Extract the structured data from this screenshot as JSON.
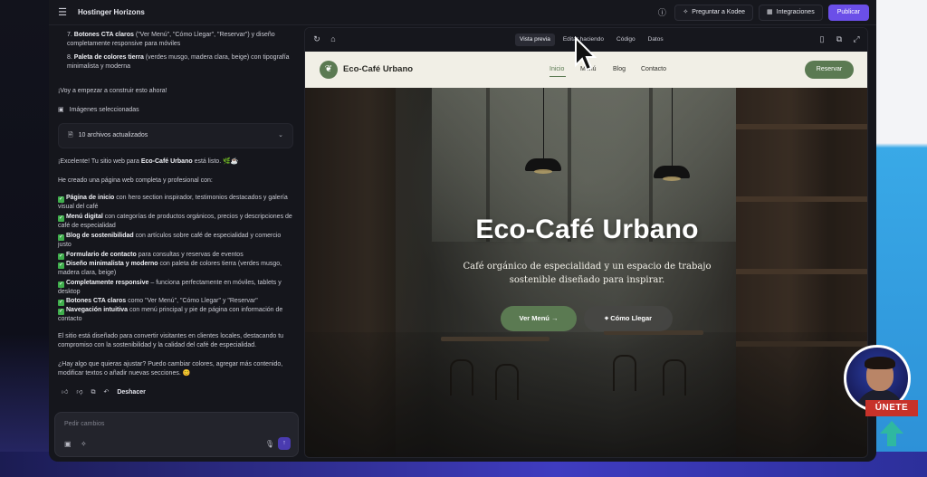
{
  "app": {
    "title": "Hostinger Horizons"
  },
  "toolbar": {
    "ask_label": "Preguntar a Kodee",
    "integrations_label": "Integraciones",
    "publish_label": "Publicar"
  },
  "chat": {
    "item7_bold": "Botones CTA claros",
    "item7_rest": " (\"Ver Menú\", \"Cómo Llegar\", \"Reservar\") y diseño completamente responsive para móviles",
    "item8_bold": "Paleta de colores tierra",
    "item8_rest": " (verdes musgo, madera clara, beige) con tipografía minimalista y moderna",
    "start_msg": "¡Voy a empezar a construir esto ahora!",
    "images_selected": "Imágenes seleccionadas",
    "files_updated": "10 archivos actualizados",
    "ready_pre": "¡Excelente! Tu sitio web para ",
    "ready_bold": "Eco-Café Urbano",
    "ready_post": " está listo. 🌿☕",
    "created_msg": "He creado una página web completa y profesional con:",
    "features": [
      {
        "bold": "Página de inicio",
        "rest": " con hero section inspirador, testimonios destacados y galería visual del café"
      },
      {
        "bold": "Menú digital",
        "rest": " con categorías de productos orgánicos, precios y descripciones de café de especialidad"
      },
      {
        "bold": "Blog de sostenibilidad",
        "rest": " con artículos sobre café de especialidad y comercio justo"
      },
      {
        "bold": "Formulario de contacto",
        "rest": " para consultas y reservas de eventos"
      },
      {
        "bold": "Diseño minimalista y moderno",
        "rest": " con paleta de colores tierra (verdes musgo, madera clara, beige)"
      },
      {
        "bold": "Completamente responsive",
        "rest": " – funciona perfectamente en móviles, tablets y desktop"
      },
      {
        "bold": "Botones CTA claros",
        "rest": " como \"Ver Menú\", \"Cómo Llegar\" y \"Reservar\""
      },
      {
        "bold": "Navegación intuitiva",
        "rest": " con menú principal y pie de página con información de contacto"
      }
    ],
    "closing": "El sitio está diseñado para convertir visitantes en clientes locales, destacando tu compromiso con la sostenibilidad y la calidad del café de especialidad.",
    "question": "¿Hay algo que quieras ajustar? Puedo cambiar colores, agregar más contenido, modificar textos o añadir nuevas secciones. 😊",
    "undo_label": "Deshacer",
    "composer_placeholder": "Pedir cambios"
  },
  "preview": {
    "tabs": [
      "Vista previa",
      "Editar haciendo",
      "Código",
      "Datos"
    ]
  },
  "site": {
    "brand": "Eco-Café Urbano",
    "nav": [
      "Inicio",
      "Menú",
      "Blog",
      "Contacto"
    ],
    "reserve": "Reservar",
    "hero_title": "Eco-Café Urbano",
    "hero_subtitle": "Café orgánico de especialidad y un espacio de trabajo sostenible diseñado para inspirar.",
    "btn_menu": "Ver Menú",
    "btn_directions": "Cómo Llegar"
  },
  "overlay": {
    "join_label": "ÚNETE"
  },
  "colors": {
    "accent": "#6b4fe8",
    "moss": "#5b7a52",
    "beige": "#f1efe6"
  }
}
